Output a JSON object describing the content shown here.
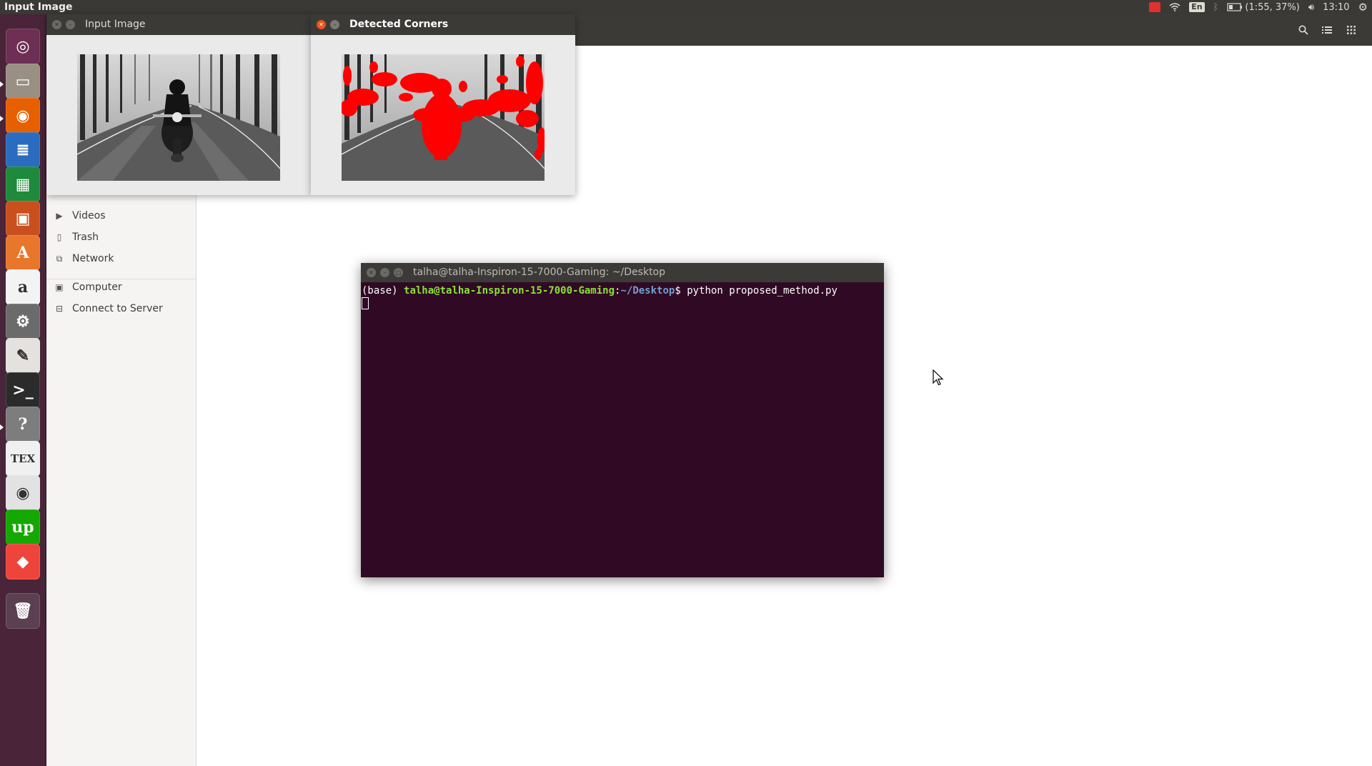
{
  "top_panel": {
    "app_title": "Input Image",
    "battery": "(1:55, 37%)",
    "keyboard_layout": "En",
    "clock": "13:10"
  },
  "launcher": {
    "items": [
      {
        "name": "ubuntu-dash-icon",
        "glyph": "◎",
        "color": "#6e2f55"
      },
      {
        "name": "files-icon",
        "glyph": "▭",
        "color": "#9a8f83"
      },
      {
        "name": "firefox-icon",
        "glyph": "◉",
        "color": "#e66000"
      },
      {
        "name": "libreoffice-writer-icon",
        "glyph": "≣",
        "color": "#2a6cbf"
      },
      {
        "name": "libreoffice-calc-icon",
        "glyph": "▦",
        "color": "#1e8a3c"
      },
      {
        "name": "libreoffice-impress-icon",
        "glyph": "▣",
        "color": "#c9501e"
      },
      {
        "name": "software-center-icon",
        "glyph": "A",
        "color": "#e8762b"
      },
      {
        "name": "amazon-icon",
        "glyph": "a",
        "color": "#f3f3f3"
      },
      {
        "name": "system-settings-icon",
        "glyph": "⚙",
        "color": "#6b6b6b"
      },
      {
        "name": "document-viewer-icon",
        "glyph": "✎",
        "color": "#e4e2df"
      },
      {
        "name": "terminal-icon",
        "glyph": ">_",
        "color": "#2b2b2b"
      },
      {
        "name": "help-icon",
        "glyph": "?",
        "color": "#7d7d7d"
      },
      {
        "name": "tex-icon",
        "glyph": "TEX",
        "color": "#f0f0f0"
      },
      {
        "name": "chrome-icon",
        "glyph": "◉",
        "color": "#e2e2e2"
      },
      {
        "name": "upwork-icon",
        "glyph": "up",
        "color": "#14a800"
      },
      {
        "name": "anydesk-icon",
        "glyph": "◆",
        "color": "#ef443b"
      },
      {
        "name": "trash-icon",
        "glyph": "🗑",
        "color": "#5a4050"
      }
    ]
  },
  "file_manager": {
    "sidebar": {
      "items": [
        {
          "label": "Videos",
          "icon": "video-icon"
        },
        {
          "label": "Trash",
          "icon": "trash-icon"
        },
        {
          "label": "Network",
          "icon": "network-icon"
        },
        {
          "label": "Computer",
          "icon": "computer-icon"
        },
        {
          "label": "Connect to Server",
          "icon": "server-icon"
        }
      ]
    }
  },
  "windows": {
    "input_image": {
      "title": "Input Image"
    },
    "detected_corners": {
      "title": "Detected Corners"
    }
  },
  "terminal": {
    "title": "talha@talha-Inspiron-15-7000-Gaming: ~/Desktop",
    "env": "(base) ",
    "user_host": "talha@talha-Inspiron-15-7000-Gaming",
    "colon": ":",
    "path": "~/Desktop",
    "prompt_char": "$ ",
    "command": "python proposed_method.py"
  }
}
